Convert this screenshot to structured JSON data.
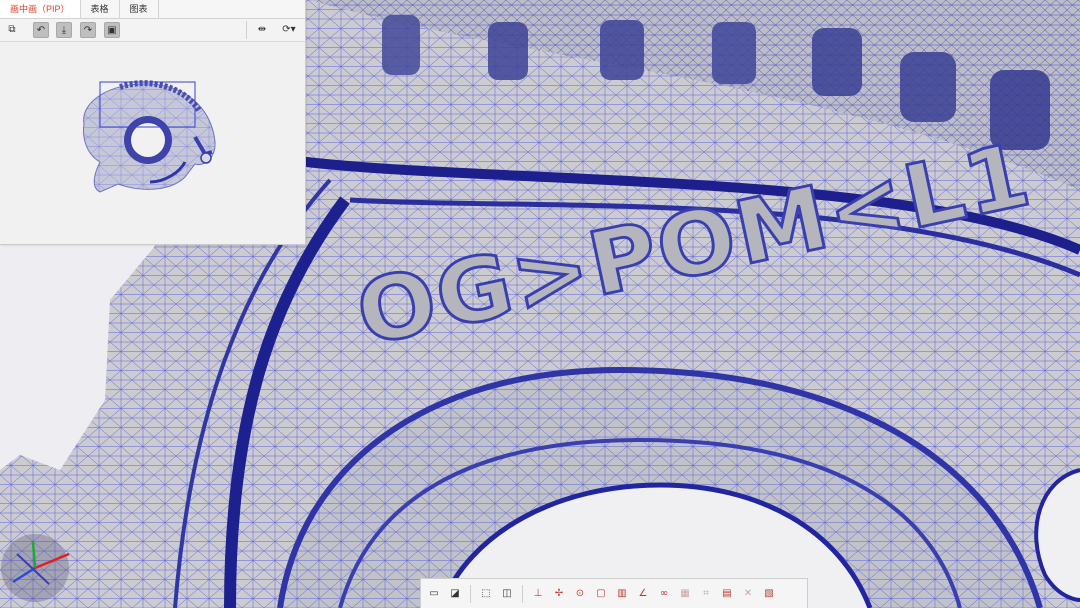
{
  "pip": {
    "tabs": [
      {
        "label": "画中画（PIP）",
        "active": true
      },
      {
        "label": "表格",
        "active": false
      },
      {
        "label": "图表",
        "active": false
      }
    ],
    "toolbar_left_icons": [
      "copy-window-icon",
      "rotate-left-icon",
      "download-icon",
      "rotate-right-icon",
      "frame-icon"
    ],
    "toolbar_right_icons": [
      "mirror-icon",
      "view-options-icon"
    ]
  },
  "viewport": {
    "part_marking": "OG>POM<L1",
    "mesh_color": "#3a3fd1",
    "surface_color": "#cdcdd2"
  },
  "bottom_toolbar": {
    "icons": [
      "select-box-icon",
      "section-icon",
      "zoom-box-icon",
      "compare-icon",
      "align-icon",
      "datum-icon",
      "point-icon",
      "box-icon",
      "chart-icon",
      "angle-icon",
      "link-icon",
      "grid-icon",
      "fit-icon",
      "export-icon",
      "delete-icon",
      "report-icon"
    ]
  },
  "colors": {
    "accent": "#d4452b",
    "mesh": "#3a3fd1"
  }
}
